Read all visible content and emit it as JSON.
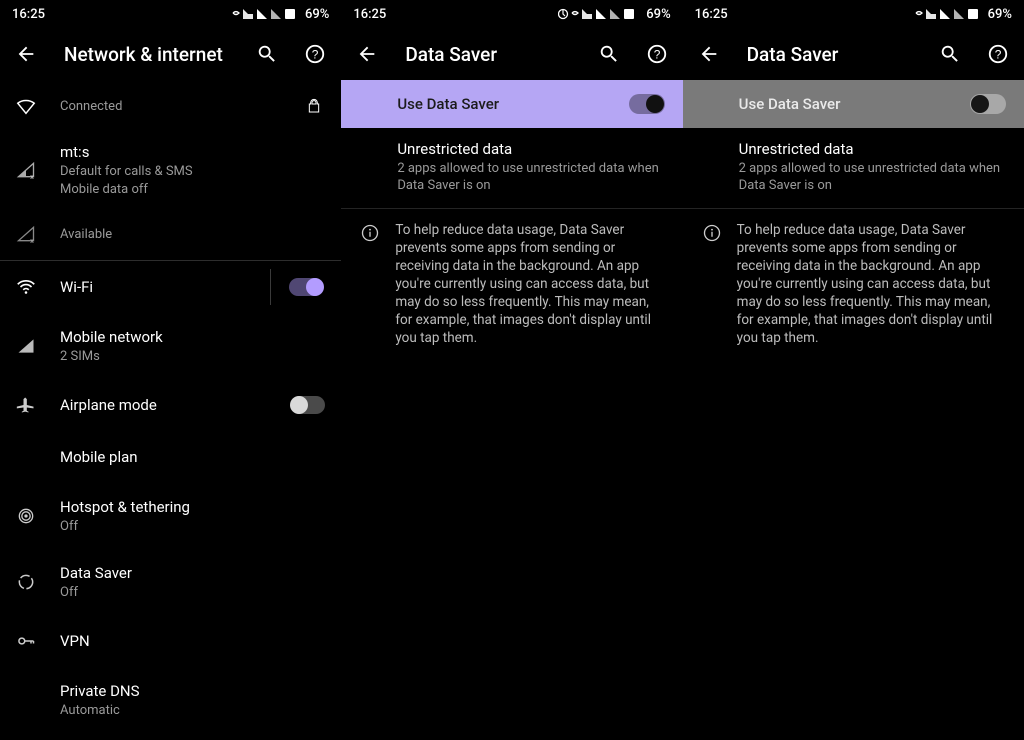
{
  "status": {
    "time": "16:25",
    "battery": "69%"
  },
  "panel1": {
    "title": "Network & internet",
    "rows": {
      "connected": {
        "sub": "Connected"
      },
      "sim1": {
        "title": "mt:s",
        "sub1": "Default for calls & SMS",
        "sub2": "Mobile data off"
      },
      "sim2": {
        "sub": "Available"
      },
      "wifi": {
        "title": "Wi-Fi"
      },
      "mobile": {
        "title": "Mobile network",
        "sub": "2 SIMs"
      },
      "airplane": {
        "title": "Airplane mode"
      },
      "plan": {
        "title": "Mobile plan"
      },
      "hotspot": {
        "title": "Hotspot & tethering",
        "sub": "Off"
      },
      "datasaver": {
        "title": "Data Saver",
        "sub": "Off"
      },
      "vpn": {
        "title": "VPN"
      },
      "dns": {
        "title": "Private DNS",
        "sub": "Automatic"
      }
    }
  },
  "panel2": {
    "title": "Data Saver",
    "hero_label": "Use Data Saver",
    "unrestricted": {
      "title": "Unrestricted data",
      "sub": "2 apps allowed to use unrestricted data when Data Saver is on"
    },
    "info": "To help reduce data usage, Data Saver prevents some apps from sending or receiving data in the background. An app you're currently using can access data, but may do so less frequently. This may mean, for example, that images don't display until you tap them."
  },
  "panel3": {
    "title": "Data Saver",
    "hero_label": "Use Data Saver",
    "unrestricted": {
      "title": "Unrestricted data",
      "sub": "2 apps allowed to use unrestricted data when Data Saver is on"
    },
    "info": "To help reduce data usage, Data Saver prevents some apps from sending or receiving data in the background. An app you're currently using can access data, but may do so less frequently. This may mean, for example, that images don't display until you tap them."
  }
}
